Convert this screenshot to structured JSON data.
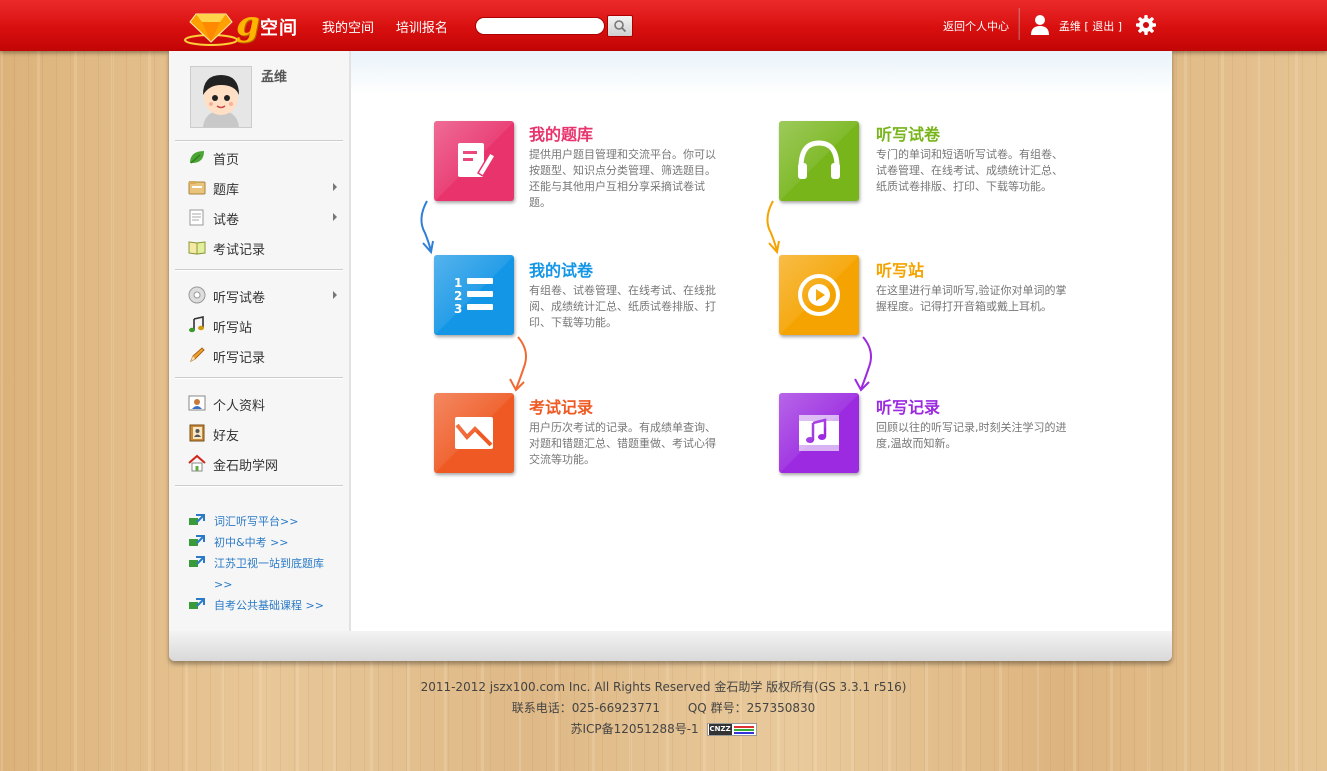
{
  "topbar": {
    "logo_text": "空间",
    "nav": [
      "我的空间",
      "培训报名"
    ],
    "search_placeholder": "",
    "back_link": "返回个人中心",
    "user_name": "孟维",
    "logout": "[ 退出 ]"
  },
  "sidebar": {
    "profile_name": "孟维",
    "group1": [
      {
        "label": "首页",
        "icon": "leaf-icon",
        "has_arrow": false
      },
      {
        "label": "题库",
        "icon": "folder-icon",
        "has_arrow": true
      },
      {
        "label": "试卷",
        "icon": "paper-icon",
        "has_arrow": true
      },
      {
        "label": "考试记录",
        "icon": "book-icon",
        "has_arrow": false
      }
    ],
    "group2": [
      {
        "label": "听写试卷",
        "icon": "disc-icon",
        "has_arrow": true
      },
      {
        "label": "听写站",
        "icon": "music-note-icon",
        "has_arrow": false
      },
      {
        "label": "听写记录",
        "icon": "pencil-icon",
        "has_arrow": false
      }
    ],
    "group3": [
      {
        "label": "个人资料",
        "icon": "profile-card-icon"
      },
      {
        "label": "好友",
        "icon": "contacts-icon"
      },
      {
        "label": "金石助学网",
        "icon": "home-icon"
      }
    ],
    "links": [
      "词汇听写平台>>",
      "初中&中考 >>",
      "江苏卫视一站到底题库 >>",
      "自考公共基础课程 >>"
    ]
  },
  "cards": [
    {
      "title": "我的题库",
      "color": "#e8336d",
      "desc": "提供用户题目管理和交流平台。你可以按题型、知识点分类管理、筛选题目。还能与其他用户互相分享采摘试卷试题。"
    },
    {
      "title": "听写试卷",
      "color": "#77b51b",
      "desc": "专门的单词和短语听写试卷。有组卷、试卷管理、在线考试、成绩统计汇总、纸质试卷排版、打印、下载等功能。"
    },
    {
      "title": "我的试卷",
      "color": "#1496e6",
      "desc": "有组卷、试卷管理、在线考试、在线批阅、成绩统计汇总、纸质试卷排版、打印、下载等功能。"
    },
    {
      "title": "听写站",
      "color": "#f5a300",
      "desc": "在这里进行单词听写,验证你对单词的掌握程度。记得打开音箱或戴上耳机。"
    },
    {
      "title": "考试记录",
      "color": "#ef5a24",
      "desc": "用户历次考试的记录。有成绩单查询、对题和错题汇总、错题重做、考试心得交流等功能。"
    },
    {
      "title": "听写记录",
      "color": "#9b2ae0",
      "desc": "回顾以往的听写记录,时刻关注学习的进度,温故而知新。"
    }
  ],
  "footer": {
    "line1": "2011-2012 jszx100.com Inc. All Rights Reserved 金石助学 版权所有(GS 3.3.1 r516)",
    "phone": "联系电话：025-66923771",
    "qq": "QQ 群号：257350830",
    "icp": "苏ICP备12051288号-1",
    "cnzz": "CNZZ"
  }
}
